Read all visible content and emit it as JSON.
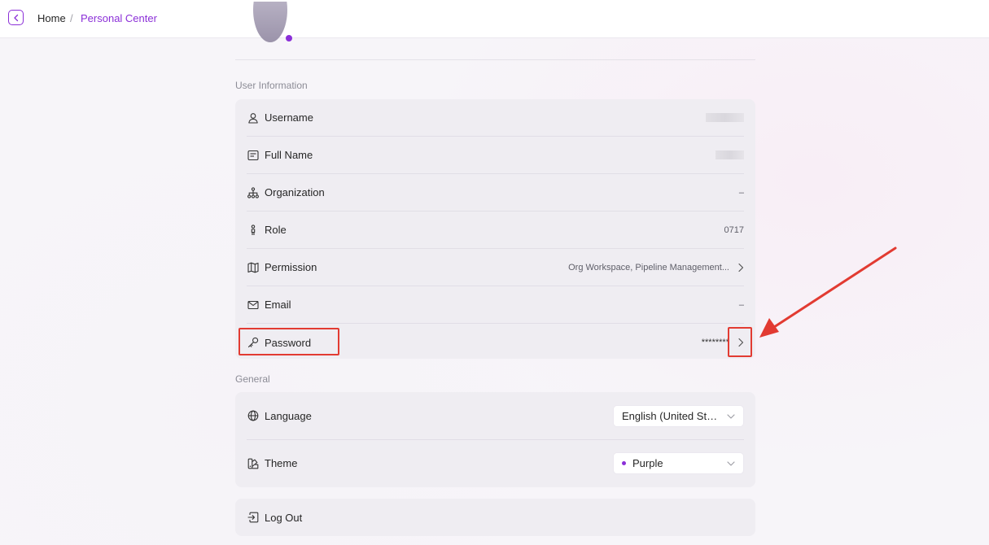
{
  "breadcrumb": {
    "home": "Home",
    "separator": "/",
    "current": "Personal Center"
  },
  "colors": {
    "accent": "#8b2fd8",
    "annotation": "#e23b32"
  },
  "user_information": {
    "title": "User Information",
    "rows": [
      {
        "label": "Username",
        "icon": "user-icon",
        "value": ""
      },
      {
        "label": "Full Name",
        "icon": "id-card-icon",
        "value": ""
      },
      {
        "label": "Organization",
        "icon": "org-tree-icon",
        "value": "–"
      },
      {
        "label": "Role",
        "icon": "person-icon",
        "value": "0717"
      },
      {
        "label": "Permission",
        "icon": "map-icon",
        "value": "Org Workspace, Pipeline Management..."
      },
      {
        "label": "Email",
        "icon": "mail-icon",
        "value": "–"
      },
      {
        "label": "Password",
        "icon": "key-icon",
        "value": "********"
      }
    ]
  },
  "general": {
    "title": "General",
    "language": {
      "label": "Language",
      "icon": "globe-icon",
      "selected": "English (United States)"
    },
    "theme": {
      "label": "Theme",
      "icon": "palette-icon",
      "selected": "Purple"
    }
  },
  "logout": {
    "label": "Log Out",
    "icon": "logout-icon"
  }
}
